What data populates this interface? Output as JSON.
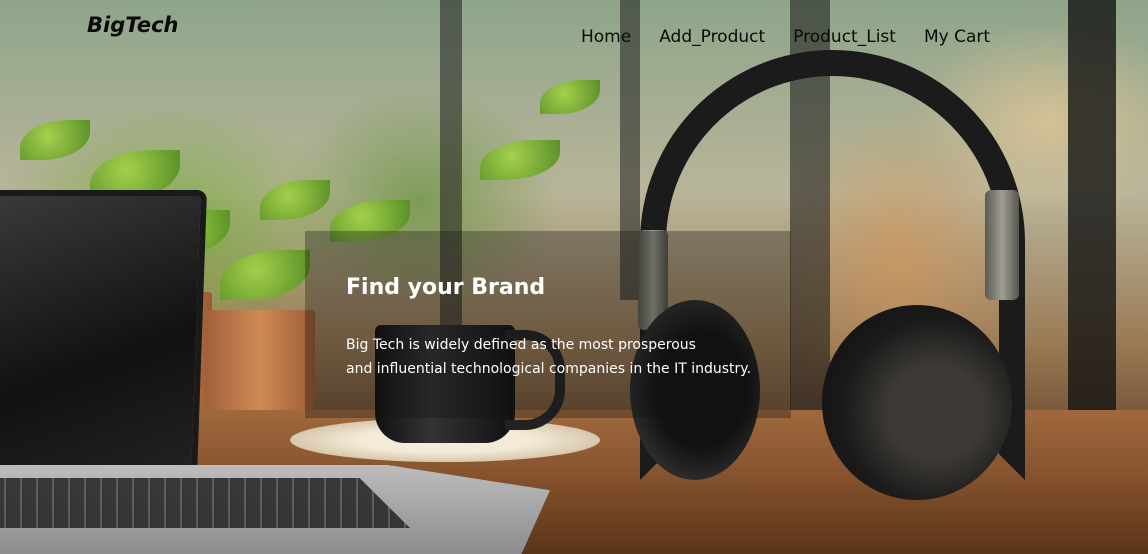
{
  "navbar": {
    "logo": "BigTech",
    "links": [
      {
        "label": "Home"
      },
      {
        "label": "Add_Product"
      },
      {
        "label": "Product_List"
      },
      {
        "label": "My Cart"
      }
    ]
  },
  "hero": {
    "title": "Find your Brand",
    "description_lines": [
      "Big Tech is widely defined as the most prosperous",
      "and influential technological companies in the IT industry."
    ],
    "background_image": "headphones-on-desk-photo"
  }
}
